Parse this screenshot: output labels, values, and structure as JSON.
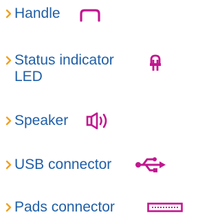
{
  "items": [
    {
      "label": "Handle",
      "icon": "handle-icon"
    },
    {
      "label": "Status indicator LED",
      "icon": "led-icon"
    },
    {
      "label": "Speaker",
      "icon": "speaker-icon"
    },
    {
      "label": "USB connector",
      "icon": "usb-icon"
    },
    {
      "label": "Pads connector",
      "icon": "pads-connector-icon"
    }
  ],
  "colors": {
    "text": "#1f5fa8",
    "chevron": "#f0a020",
    "icon": "#c2178f"
  }
}
